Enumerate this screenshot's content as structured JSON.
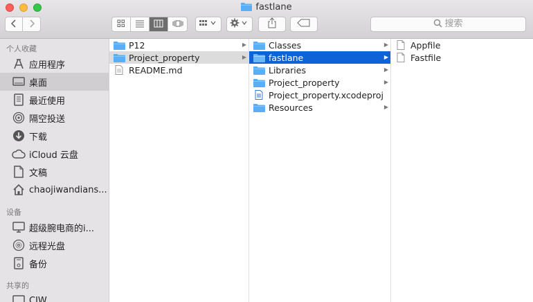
{
  "window": {
    "title": "fastlane"
  },
  "toolbar": {
    "back_icon": "chevron-left-icon",
    "forward_icon": "chevron-right-icon",
    "view_icons": [
      "icon-view-icon",
      "list-view-icon",
      "column-view-icon",
      "cover-flow-icon"
    ],
    "active_view": "column-view-icon",
    "search_placeholder": "搜索"
  },
  "sidebar": {
    "favorites_header": "个人收藏",
    "favorites": [
      {
        "label": "应用程序",
        "icon": "applications-icon"
      },
      {
        "label": "桌面",
        "icon": "desktop-icon",
        "selected": true
      },
      {
        "label": "最近使用",
        "icon": "recents-icon"
      },
      {
        "label": "隔空投送",
        "icon": "airdrop-icon"
      },
      {
        "label": "下载",
        "icon": "downloads-icon"
      },
      {
        "label": "iCloud 云盘",
        "icon": "icloud-icon"
      },
      {
        "label": "文稿",
        "icon": "documents-icon"
      },
      {
        "label": "chaojiwandians...",
        "icon": "home-icon"
      }
    ],
    "devices_header": "设备",
    "devices": [
      {
        "label": "超级腕电商的i...",
        "icon": "computer-icon"
      },
      {
        "label": "远程光盘",
        "icon": "remote-disc-icon"
      },
      {
        "label": "备份",
        "icon": "backup-icon"
      }
    ],
    "shared_header": "共享的",
    "shared": [
      {
        "label": "CJW",
        "icon": "network-icon"
      }
    ]
  },
  "columns": [
    {
      "items": [
        {
          "name": "P12",
          "type": "folder",
          "has_children": true
        },
        {
          "name": "Project_property",
          "type": "folder",
          "has_children": true,
          "state": "selected-inactive"
        },
        {
          "name": "README.md",
          "type": "text-file"
        }
      ]
    },
    {
      "items": [
        {
          "name": "Classes",
          "type": "folder",
          "has_children": true
        },
        {
          "name": "fastlane",
          "type": "folder",
          "has_children": true,
          "state": "selected-active"
        },
        {
          "name": "Libraries",
          "type": "folder",
          "has_children": true
        },
        {
          "name": "Project_property",
          "type": "folder",
          "has_children": true
        },
        {
          "name": "Project_property.xcodeproj",
          "type": "xcodeproj"
        },
        {
          "name": "Resources",
          "type": "folder",
          "has_children": true
        }
      ]
    },
    {
      "items": [
        {
          "name": "Appfile",
          "type": "file"
        },
        {
          "name": "Fastfile",
          "type": "file"
        }
      ]
    }
  ],
  "colors": {
    "selection_blue": "#0f63d6",
    "folder_blue": "#5aaef5"
  }
}
